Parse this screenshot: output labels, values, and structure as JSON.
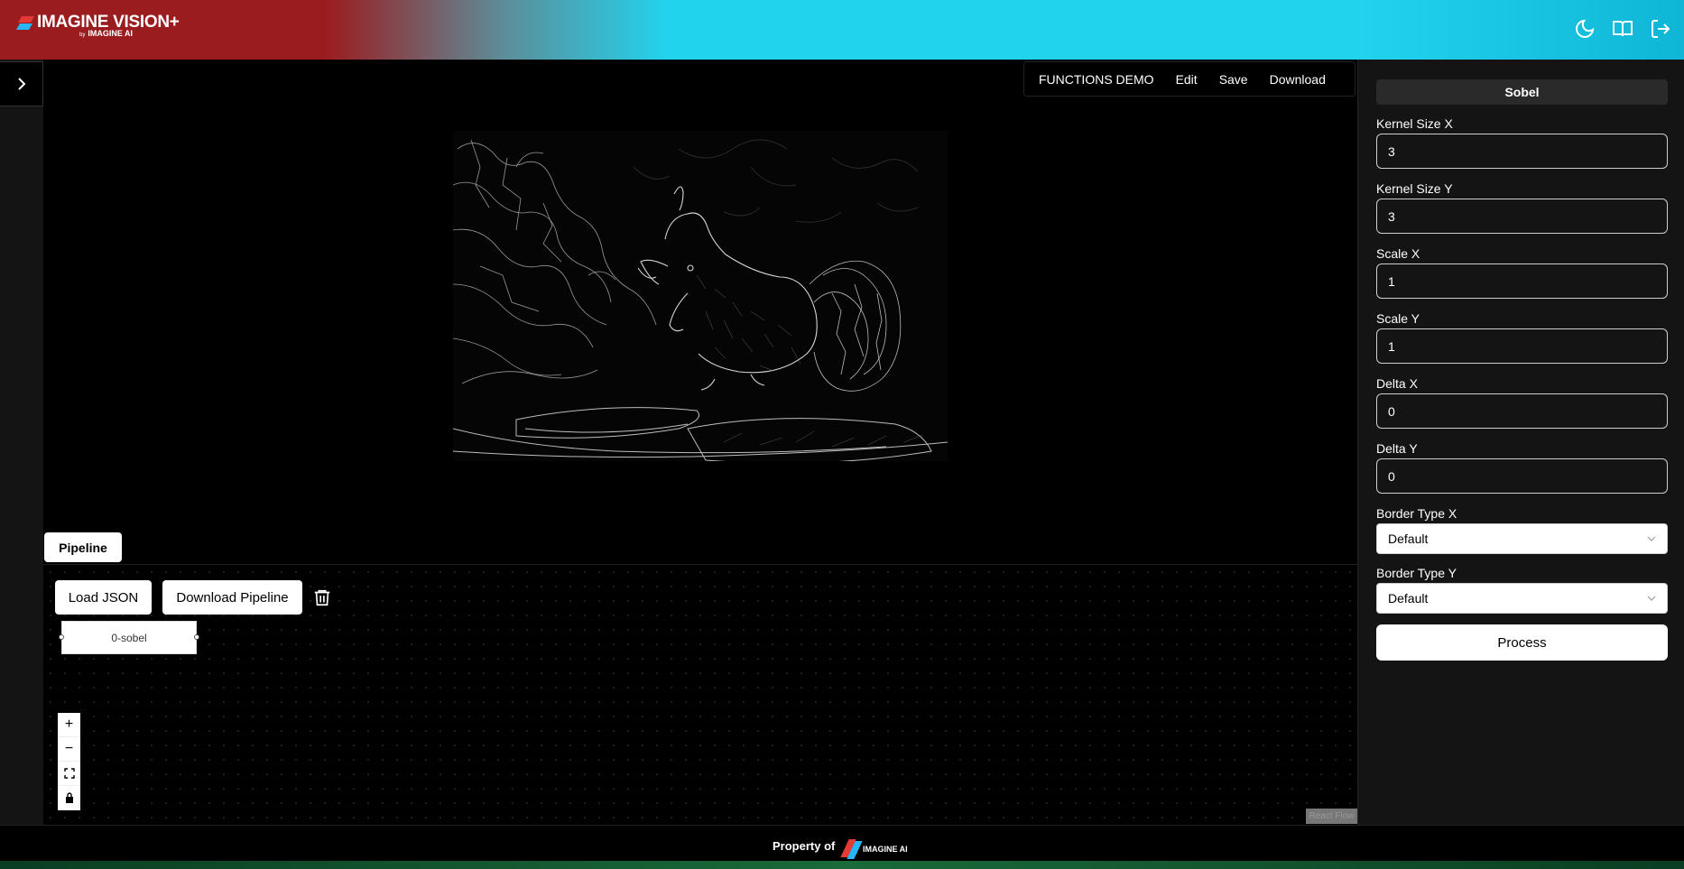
{
  "app": {
    "brand": "IMAGINE VISION+",
    "brand_by": "by",
    "brand_company": "IMAGINE AI"
  },
  "header": {
    "icons": [
      "moon-icon",
      "book-icon",
      "logout-icon"
    ]
  },
  "top_menu": {
    "items": [
      "FUNCTIONS DEMO",
      "Edit",
      "Save",
      "Download"
    ]
  },
  "pipeline": {
    "tab_label": "Pipeline",
    "load_json_label": "Load JSON",
    "download_pipeline_label": "Download Pipeline",
    "node_label": "0-sobel",
    "attribution": "React Flow"
  },
  "panel": {
    "title": "Sobel",
    "fields": [
      {
        "label": "Kernel Size X",
        "value": "3"
      },
      {
        "label": "Kernel Size Y",
        "value": "3"
      },
      {
        "label": "Scale X",
        "value": "1"
      },
      {
        "label": "Scale Y",
        "value": "1"
      },
      {
        "label": "Delta X",
        "value": "0"
      },
      {
        "label": "Delta Y",
        "value": "0"
      }
    ],
    "selects": [
      {
        "label": "Border Type X",
        "value": "Default"
      },
      {
        "label": "Border Type Y",
        "value": "Default"
      }
    ],
    "process_label": "Process"
  },
  "footer": {
    "property_of": "Property of",
    "company": "IMAGINE AI"
  },
  "colors": {
    "header_red": "#9b1c1f",
    "header_cyan": "#22d3ee",
    "panel_bg": "#141414"
  }
}
